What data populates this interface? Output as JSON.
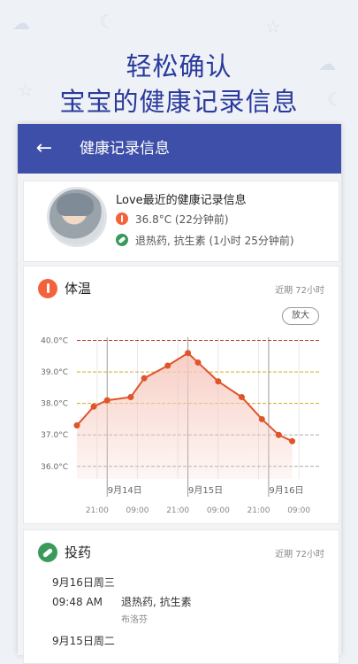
{
  "headline": [
    "轻松确认",
    "宝宝的健康记录信息"
  ],
  "appbar": {
    "title": "健康记录信息"
  },
  "profile": {
    "title": "Love最近的健康记录信息",
    "temp_line": "36.8°C (22分钟前)",
    "med_line": "退热药, 抗生素 (1小时 25分钟前)"
  },
  "temperature": {
    "title": "体温",
    "range": "近期 72小时",
    "zoom_label": "放大"
  },
  "chart_data": {
    "type": "line",
    "ylim": [
      35.6,
      40.1
    ],
    "y_ticks": [
      "40.0°C",
      "39.0°C",
      "38.0°C",
      "37.0°C",
      "36.0°C"
    ],
    "y_tick_values": [
      40.0,
      39.0,
      38.0,
      37.0,
      36.0
    ],
    "x_ticks": [
      "21:00",
      "09:00",
      "21:00",
      "09:00",
      "21:00",
      "09:00"
    ],
    "day_labels": [
      "9月14日",
      "9月15日",
      "9月16日"
    ],
    "hours_span": 72,
    "x_tick_hours": [
      6,
      18,
      30,
      42,
      54,
      66
    ],
    "day_hours": [
      9,
      33,
      57
    ],
    "points": [
      {
        "h": 0,
        "v": 37.3
      },
      {
        "h": 5,
        "v": 37.9
      },
      {
        "h": 9,
        "v": 38.1
      },
      {
        "h": 16,
        "v": 38.2
      },
      {
        "h": 20,
        "v": 38.8
      },
      {
        "h": 27,
        "v": 39.2
      },
      {
        "h": 33,
        "v": 39.6
      },
      {
        "h": 36,
        "v": 39.3
      },
      {
        "h": 42,
        "v": 38.7
      },
      {
        "h": 49,
        "v": 38.2
      },
      {
        "h": 55,
        "v": 37.5
      },
      {
        "h": 60,
        "v": 37.0
      },
      {
        "h": 64,
        "v": 36.8
      }
    ],
    "line_color": "#e0542b",
    "fill_color": "#f6c9bf"
  },
  "medication": {
    "title": "投药",
    "range": "近期 72小时",
    "entries": [
      {
        "date": "9月16日周三",
        "time": "09:48 AM",
        "name": "退热药, 抗生素",
        "sub": "布洛芬"
      },
      {
        "date": "9月15日周二"
      }
    ]
  }
}
